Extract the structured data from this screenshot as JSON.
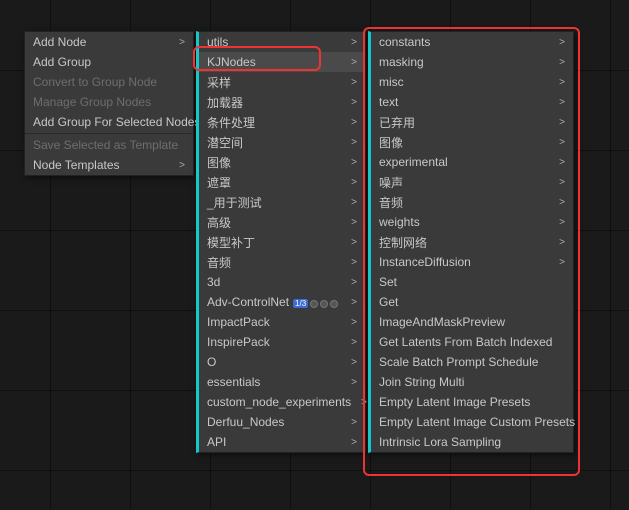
{
  "menu1": {
    "items": [
      {
        "label": "Add Node",
        "arrow": true,
        "disabled": false
      },
      {
        "label": "Add Group",
        "arrow": false,
        "disabled": false
      },
      {
        "label": "Convert to Group Node",
        "arrow": false,
        "disabled": true
      },
      {
        "label": "Manage Group Nodes",
        "arrow": false,
        "disabled": true
      },
      {
        "label": "Add Group For Selected Nodes",
        "arrow": false,
        "disabled": false
      }
    ],
    "items2": [
      {
        "label": "Save Selected as Template",
        "arrow": false,
        "disabled": true
      },
      {
        "label": "Node Templates",
        "arrow": true,
        "disabled": false
      }
    ]
  },
  "menu2": {
    "items": [
      {
        "label": "utils",
        "arrow": true
      },
      {
        "label": "KJNodes",
        "arrow": true,
        "hover": true
      },
      {
        "label": "采样",
        "arrow": true
      },
      {
        "label": "加载器",
        "arrow": true
      },
      {
        "label": "条件处理",
        "arrow": true
      },
      {
        "label": "潜空间",
        "arrow": true
      },
      {
        "label": "图像",
        "arrow": true
      },
      {
        "label": "遮罩",
        "arrow": true
      },
      {
        "label": "_用于测试",
        "arrow": true
      },
      {
        "label": "高级",
        "arrow": true
      },
      {
        "label": "模型补丁",
        "arrow": true
      },
      {
        "label": "音频",
        "arrow": true
      },
      {
        "label": "3d",
        "arrow": true
      },
      {
        "label": "Adv-ControlNet",
        "arrow": true,
        "badges": true
      },
      {
        "label": "ImpactPack",
        "arrow": true
      },
      {
        "label": "InspirePack",
        "arrow": true
      },
      {
        "label": "O",
        "arrow": true
      },
      {
        "label": "essentials",
        "arrow": true
      },
      {
        "label": "custom_node_experiments",
        "arrow": true
      },
      {
        "label": "Derfuu_Nodes",
        "arrow": true
      },
      {
        "label": "API",
        "arrow": true
      }
    ]
  },
  "menu3": {
    "items": [
      {
        "label": "constants",
        "arrow": true
      },
      {
        "label": "masking",
        "arrow": true
      },
      {
        "label": "misc",
        "arrow": true
      },
      {
        "label": "text",
        "arrow": true
      },
      {
        "label": "已弃用",
        "arrow": true
      },
      {
        "label": "图像",
        "arrow": true
      },
      {
        "label": "experimental",
        "arrow": true
      },
      {
        "label": "噪声",
        "arrow": true
      },
      {
        "label": "音频",
        "arrow": true
      },
      {
        "label": "weights",
        "arrow": true
      },
      {
        "label": "控制网络",
        "arrow": true
      },
      {
        "label": "InstanceDiffusion",
        "arrow": true
      },
      {
        "label": "Set",
        "arrow": false
      },
      {
        "label": "Get",
        "arrow": false
      },
      {
        "label": "ImageAndMaskPreview",
        "arrow": false
      },
      {
        "label": "Get Latents From Batch Indexed",
        "arrow": false
      },
      {
        "label": "Scale Batch Prompt Schedule",
        "arrow": false
      },
      {
        "label": "Join String Multi",
        "arrow": false
      },
      {
        "label": "Empty Latent Image Presets",
        "arrow": false
      },
      {
        "label": "Empty Latent Image Custom Presets",
        "arrow": false
      },
      {
        "label": "Intrinsic Lora Sampling",
        "arrow": false
      }
    ]
  },
  "badge_text": "1/3"
}
